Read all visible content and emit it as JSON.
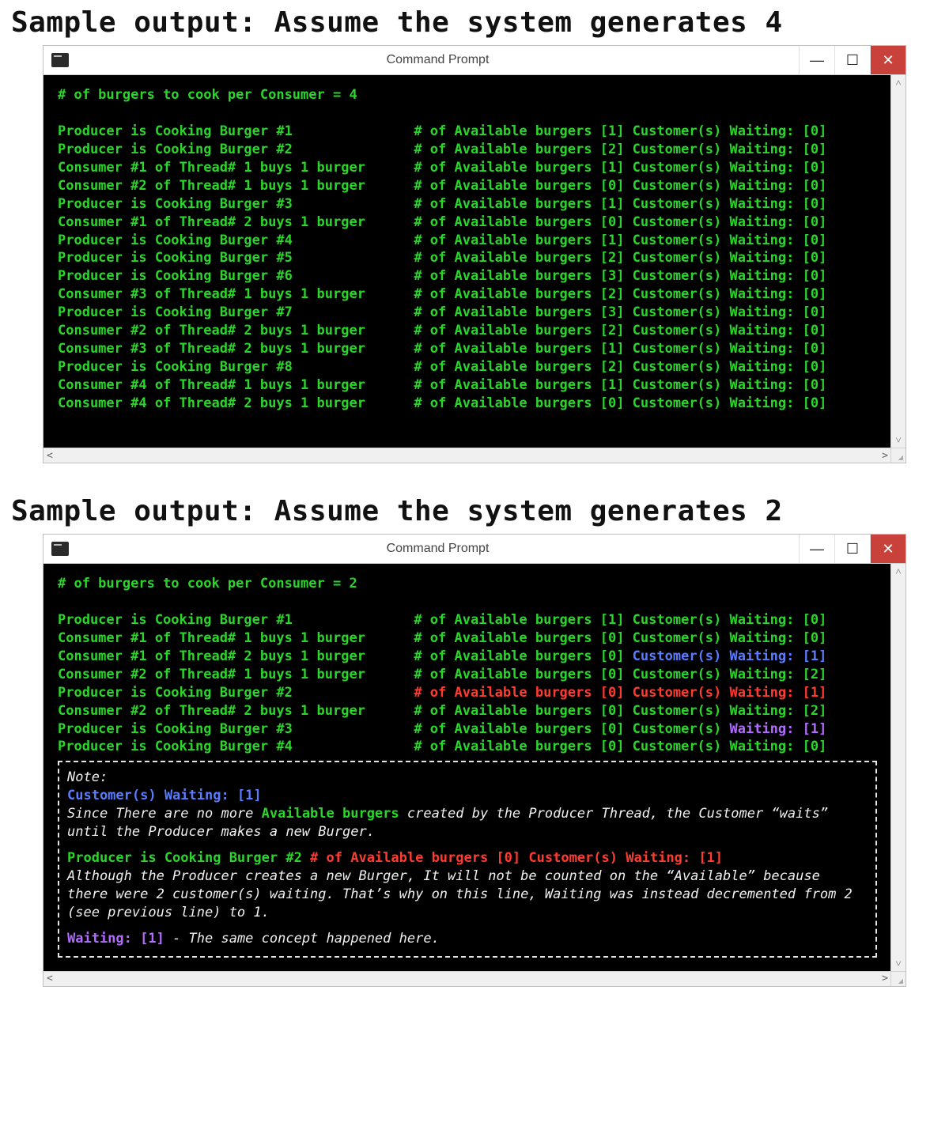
{
  "heading1": "Sample output: Assume the system generates 4",
  "heading2": "Sample output: Assume the system generates 2",
  "window_title": "Command Prompt",
  "win_buttons": {
    "minimize": "—",
    "maximize": "☐",
    "close": "✕"
  },
  "scroll": {
    "up": "˄",
    "down": "˅",
    "left": "<",
    "right": ">"
  },
  "term1_header": "# of burgers to cook per Consumer = 4",
  "term1_lines": [
    {
      "action": "Producer is Cooking Burger #1",
      "avail": 1,
      "wait": 0
    },
    {
      "action": "Producer is Cooking Burger #2",
      "avail": 2,
      "wait": 0
    },
    {
      "action": "Consumer #1 of Thread# 1 buys 1 burger",
      "avail": 1,
      "wait": 0
    },
    {
      "action": "Consumer #2 of Thread# 1 buys 1 burger",
      "avail": 0,
      "wait": 0
    },
    {
      "action": "Producer is Cooking Burger #3",
      "avail": 1,
      "wait": 0
    },
    {
      "action": "Consumer #1 of Thread# 2 buys 1 burger",
      "avail": 0,
      "wait": 0
    },
    {
      "action": "Producer is Cooking Burger #4",
      "avail": 1,
      "wait": 0
    },
    {
      "action": "Producer is Cooking Burger #5",
      "avail": 2,
      "wait": 0
    },
    {
      "action": "Producer is Cooking Burger #6",
      "avail": 3,
      "wait": 0
    },
    {
      "action": "Consumer #3 of Thread# 1 buys 1 burger",
      "avail": 2,
      "wait": 0
    },
    {
      "action": "Producer is Cooking Burger #7",
      "avail": 3,
      "wait": 0
    },
    {
      "action": "Consumer #2 of Thread# 2 buys 1 burger",
      "avail": 2,
      "wait": 0
    },
    {
      "action": "Consumer #3 of Thread# 2 buys 1 burger",
      "avail": 1,
      "wait": 0
    },
    {
      "action": "Producer is Cooking Burger #8",
      "avail": 2,
      "wait": 0
    },
    {
      "action": "Consumer #4 of Thread# 1 buys 1 burger",
      "avail": 1,
      "wait": 0
    },
    {
      "action": "Consumer #4 of Thread# 2 buys 1 burger",
      "avail": 0,
      "wait": 0
    }
  ],
  "term2_header": "# of burgers to cook per Consumer = 2",
  "term2_lines": [
    {
      "action": "Producer is Cooking Burger #1",
      "avail": 1,
      "wait_text": "Customer(s) Waiting: [0]",
      "wait_class": ""
    },
    {
      "action": "Consumer #1 of Thread# 1 buys 1 burger",
      "avail": 0,
      "wait_text": "Customer(s) Waiting: [0]",
      "wait_class": ""
    },
    {
      "action": "Consumer #1 of Thread# 2 buys 1 burger",
      "avail": 0,
      "wait_text": "Customer(s) Waiting: [1]",
      "wait_class": "c-blue"
    },
    {
      "action": "Consumer #2 of Thread# 1 buys 1 burger",
      "avail": 0,
      "wait_text": "Customer(s) Waiting: [2]",
      "wait_class": ""
    },
    {
      "action": "Producer is Cooking Burger #2",
      "tail_full": "# of Available burgers [0] Customer(s) Waiting: [1]",
      "tail_class": "c-red"
    },
    {
      "action": "Consumer #2 of Thread# 2 buys 1 burger",
      "avail": 0,
      "wait_text": "Customer(s) Waiting: [2]",
      "wait_class": ""
    },
    {
      "action": "Producer is Cooking Burger #3",
      "avail": 0,
      "wait_text": "Waiting: [1]",
      "wait_prefix": "Customer(s) ",
      "wait_class": "c-purple"
    },
    {
      "action": "Producer is Cooking Burger #4",
      "avail": 0,
      "wait_text": "Customer(s) Waiting: [0]",
      "wait_class": ""
    }
  ],
  "note": {
    "heading": "Note:",
    "blue_frag": "Customer(s) Waiting: [1]",
    "p1a": "Since There are no more ",
    "p1_green": "Available burgers",
    "p1b": " created by the Producer Thread, the Customer “waits” until the Producer makes a new Burger.",
    "p2_green": "Producer is Cooking Burger #2 ",
    "p2_red": "# of Available burgers [0] Customer(s) Waiting: [1]",
    "p2_body": "Although the Producer creates a new Burger, It will not be counted on the “Available” because there were 2 customer(s) waiting. That’s why on this line, Waiting was instead decremented from 2 (see previous line) to 1.",
    "p3_purple": "Waiting: [1]",
    "p3_body": " - The same concept happened here."
  }
}
